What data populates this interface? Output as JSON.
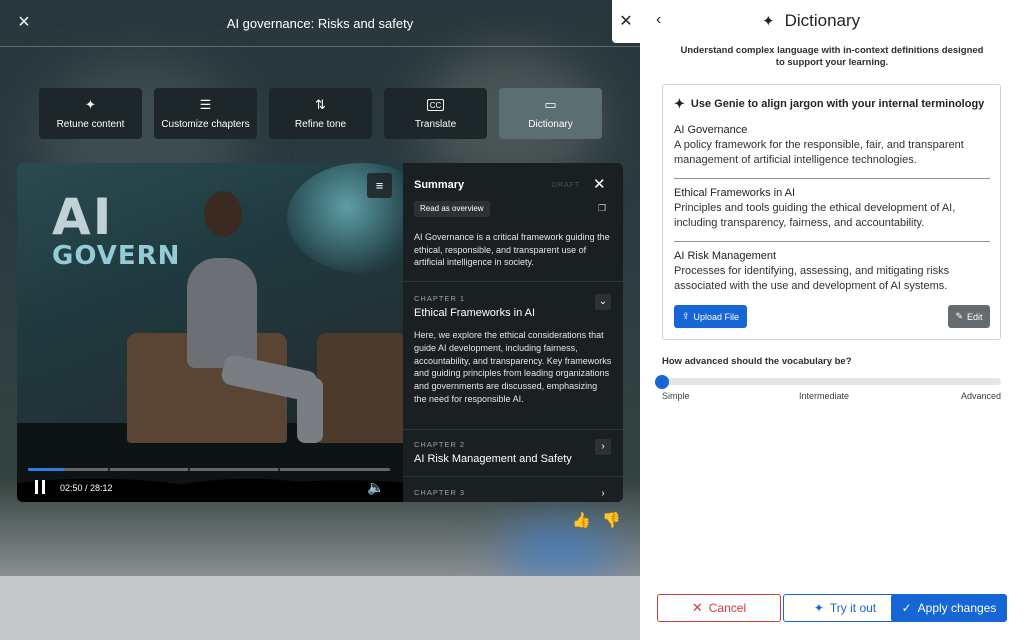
{
  "viewer": {
    "title": "AI governance: Risks and safety",
    "close_icon": "×"
  },
  "tools": [
    {
      "label": "Retune content",
      "icon": "✦"
    },
    {
      "label": "Customize chapters",
      "icon": "☰"
    },
    {
      "label": "Refine tone",
      "icon": "⇅"
    },
    {
      "label": "Translate",
      "icon": "CC"
    },
    {
      "label": "Dictionary",
      "icon": "▭"
    }
  ],
  "video": {
    "scene_text_1": "AI",
    "scene_text_2": "GOVERN",
    "time": "02:50 / 28:12",
    "progress_fraction": 0.1
  },
  "summary": {
    "heading": "Summary",
    "badge": "DRAFT",
    "read_button": "Read as overview",
    "text": "AI Governance is a critical framework guiding the ethical, responsible, and transparent use of artificial intelligence in society.",
    "chapters": [
      {
        "label": "CHAPTER 1",
        "title": "Ethical Frameworks in AI",
        "body": "Here, we explore the ethical considerations that guide AI development, including fairness, accountability, and transparency. Key frameworks and guiding principles from leading organizations and governments are discussed, emphasizing the need for responsible AI.",
        "toggle": "⌄"
      },
      {
        "label": "CHAPTER 2",
        "title": "AI Risk Management and Safety",
        "toggle": "›"
      },
      {
        "label": "CHAPTER 3",
        "toggle": "›"
      }
    ]
  },
  "dictionary": {
    "title": "Dictionary",
    "subtitle": "Understand complex language with in-context definitions designed to support your learning.",
    "card_heading": "Use Genie to align jargon with your internal terminology",
    "terms": [
      {
        "name": "AI Governance",
        "definition": "A policy framework for the responsible, fair, and transparent management of artificial intelligence technologies."
      },
      {
        "name": "Ethical Frameworks in AI",
        "definition": "Principles and tools guiding the ethical development of AI, including transparency, fairness, and accountability."
      },
      {
        "name": "AI Risk Management",
        "definition": "Processes for identifying, assessing, and mitigating risks associated with the use and development of AI systems."
      }
    ],
    "upload_label": "Upload File",
    "edit_label": "Edit",
    "vocab_question": "How advanced should the vocabulary be?",
    "vocab_levels": [
      "Simple",
      "Intermediate",
      "Advanced"
    ],
    "vocab_value_fraction": 0.0,
    "cancel_label": "Cancel",
    "try_label": "Try it out",
    "apply_label": "Apply changes"
  },
  "colors": {
    "accent": "#1766d6",
    "danger": "#d23b3b"
  }
}
